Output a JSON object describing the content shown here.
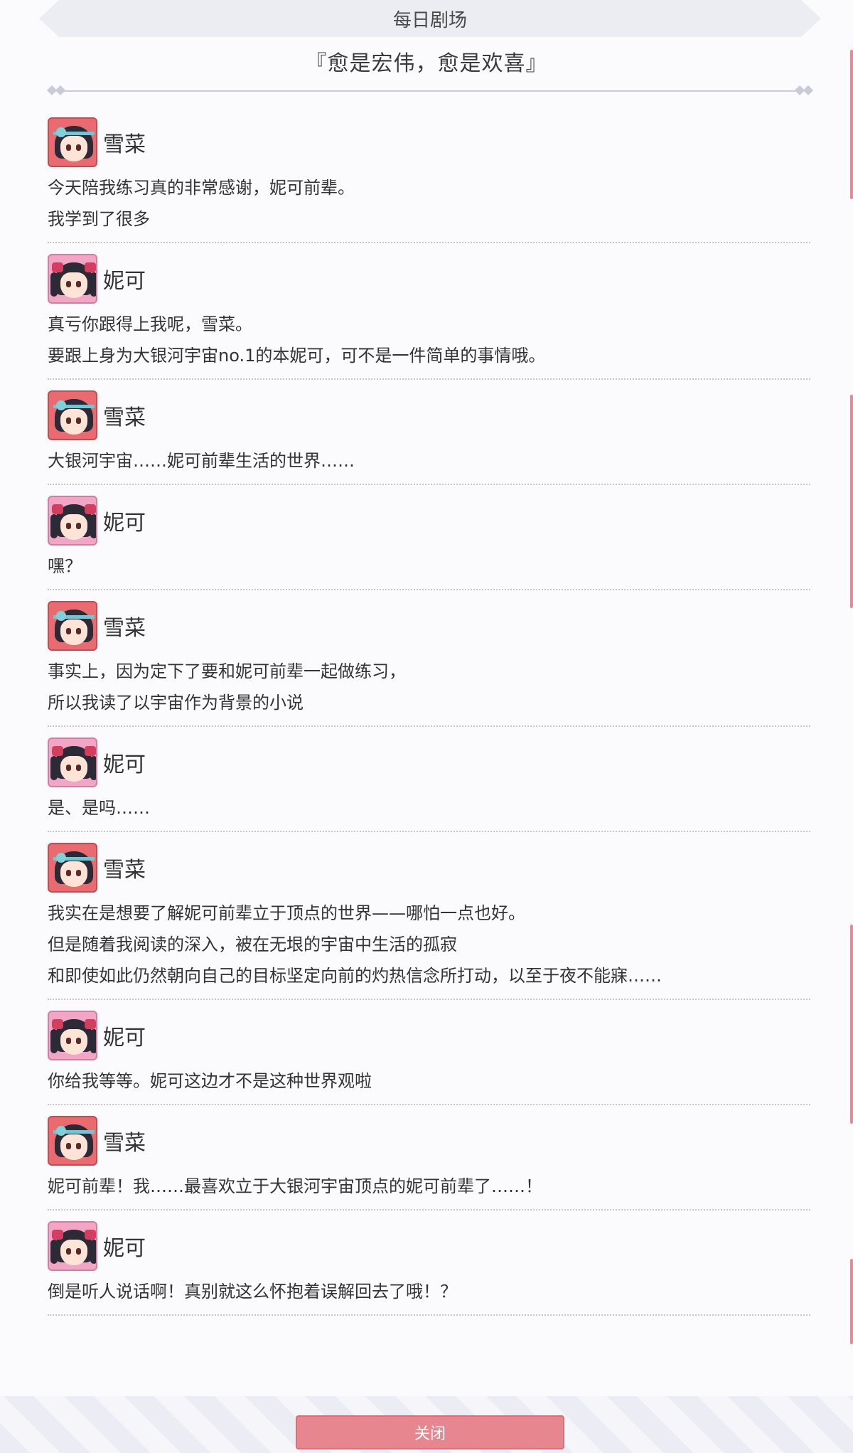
{
  "header": {
    "title": "每日剧场",
    "subtitle": "『愈是宏伟，愈是欢喜』"
  },
  "entries": [
    {
      "speaker": "雪菜",
      "avatar": "setsuna",
      "lines": [
        "今天陪我练习真的非常感谢，妮可前辈。",
        "我学到了很多"
      ]
    },
    {
      "speaker": "妮可",
      "avatar": "nico",
      "lines": [
        "真亏你跟得上我呢，雪菜。",
        "要跟上身为大银河宇宙no.1的本妮可，可不是一件简单的事情哦。"
      ]
    },
    {
      "speaker": "雪菜",
      "avatar": "setsuna",
      "lines": [
        "大银河宇宙……妮可前辈生活的世界……"
      ]
    },
    {
      "speaker": "妮可",
      "avatar": "nico",
      "lines": [
        "嘿？"
      ]
    },
    {
      "speaker": "雪菜",
      "avatar": "setsuna",
      "lines": [
        "事实上，因为定下了要和妮可前辈一起做练习，",
        "所以我读了以宇宙作为背景的小说"
      ]
    },
    {
      "speaker": "妮可",
      "avatar": "nico",
      "lines": [
        "是、是吗……"
      ]
    },
    {
      "speaker": "雪菜",
      "avatar": "setsuna",
      "lines": [
        "我实在是想要了解妮可前辈立于顶点的世界——哪怕一点也好。",
        "但是随着我阅读的深入，被在无垠的宇宙中生活的孤寂",
        "和即使如此仍然朝向自己的目标坚定向前的灼热信念所打动，以至于夜不能寐……"
      ]
    },
    {
      "speaker": "妮可",
      "avatar": "nico",
      "lines": [
        "你给我等等。妮可这边才不是这种世界观啦"
      ]
    },
    {
      "speaker": "雪菜",
      "avatar": "setsuna",
      "lines": [
        "妮可前辈！我……最喜欢立于大银河宇宙顶点的妮可前辈了……！"
      ]
    },
    {
      "speaker": "妮可",
      "avatar": "nico",
      "lines": [
        "倒是听人说话啊！真别就这么怀抱着误解回去了哦！？"
      ]
    }
  ],
  "footer": {
    "close_label": "关闭"
  }
}
